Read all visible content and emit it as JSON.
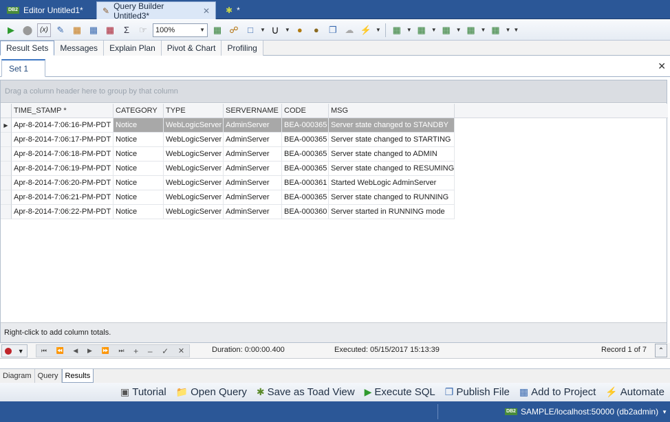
{
  "doc_tabs": [
    {
      "label": "Editor Untitled1*"
    },
    {
      "label": "Query Builder Untitled3*"
    },
    {
      "label": "*"
    }
  ],
  "toolbar": {
    "zoom": "100%"
  },
  "result_tabs": [
    "Result Sets",
    "Messages",
    "Explain Plan",
    "Pivot & Chart",
    "Profiling"
  ],
  "set_tab": "Set 1",
  "grid": {
    "group_hint": "Drag a column header here to group by that column",
    "columns": [
      "TIME_STAMP *",
      "CATEGORY",
      "TYPE",
      "SERVERNAME",
      "CODE",
      "MSG"
    ],
    "rows": [
      [
        "Apr-8-2014-7:06:16-PM-PDT",
        "Notice",
        "WebLogicServer",
        "AdminServer",
        "BEA-000365",
        "Server state changed to STANDBY"
      ],
      [
        "Apr-8-2014-7:06:17-PM-PDT",
        "Notice",
        "WebLogicServer",
        "AdminServer",
        "BEA-000365",
        "Server state changed to STARTING"
      ],
      [
        "Apr-8-2014-7:06:18-PM-PDT",
        "Notice",
        "WebLogicServer",
        "AdminServer",
        "BEA-000365",
        "Server state changed to ADMIN"
      ],
      [
        "Apr-8-2014-7:06:19-PM-PDT",
        "Notice",
        "WebLogicServer",
        "AdminServer",
        "BEA-000365",
        "Server state changed to RESUMING"
      ],
      [
        "Apr-8-2014-7:06:20-PM-PDT",
        "Notice",
        "WebLogicServer",
        "AdminServer",
        "BEA-000361",
        "Started WebLogic AdminServer"
      ],
      [
        "Apr-8-2014-7:06:21-PM-PDT",
        "Notice",
        "WebLogicServer",
        "AdminServer",
        "BEA-000365",
        "Server state changed to RUNNING"
      ],
      [
        "Apr-8-2014-7:06:22-PM-PDT",
        "Notice",
        "WebLogicServer",
        "AdminServer",
        "BEA-000360",
        "Server started in RUNNING mode"
      ]
    ],
    "totals_hint": "Right-click to add column totals."
  },
  "navigator": {
    "duration": "Duration: 0:00:00.400",
    "executed": "Executed: 05/15/2017 15:13:39",
    "record": "Record 1 of 7"
  },
  "pane_tabs": [
    "Diagram",
    "Query",
    "Results"
  ],
  "actions": [
    {
      "label": "Tutorial",
      "icon": "camera-icon"
    },
    {
      "label": "Open Query",
      "icon": "folder-icon"
    },
    {
      "label": "Save as Toad View",
      "icon": "toad-view-icon"
    },
    {
      "label": "Execute SQL",
      "icon": "play-icon"
    },
    {
      "label": "Publish File",
      "icon": "publish-icon"
    },
    {
      "label": "Add to Project",
      "icon": "project-icon"
    },
    {
      "label": "Automate",
      "icon": "automate-icon"
    }
  ],
  "status": {
    "connection": "SAMPLE/localhost:50000 (db2admin)",
    "db_badge": "DB2"
  },
  "colors": {
    "chrome_blue": "#2b5797",
    "selected_row": "#a8a8a8",
    "run_green": "#2e9a2e",
    "record_red": "#c0252b"
  }
}
